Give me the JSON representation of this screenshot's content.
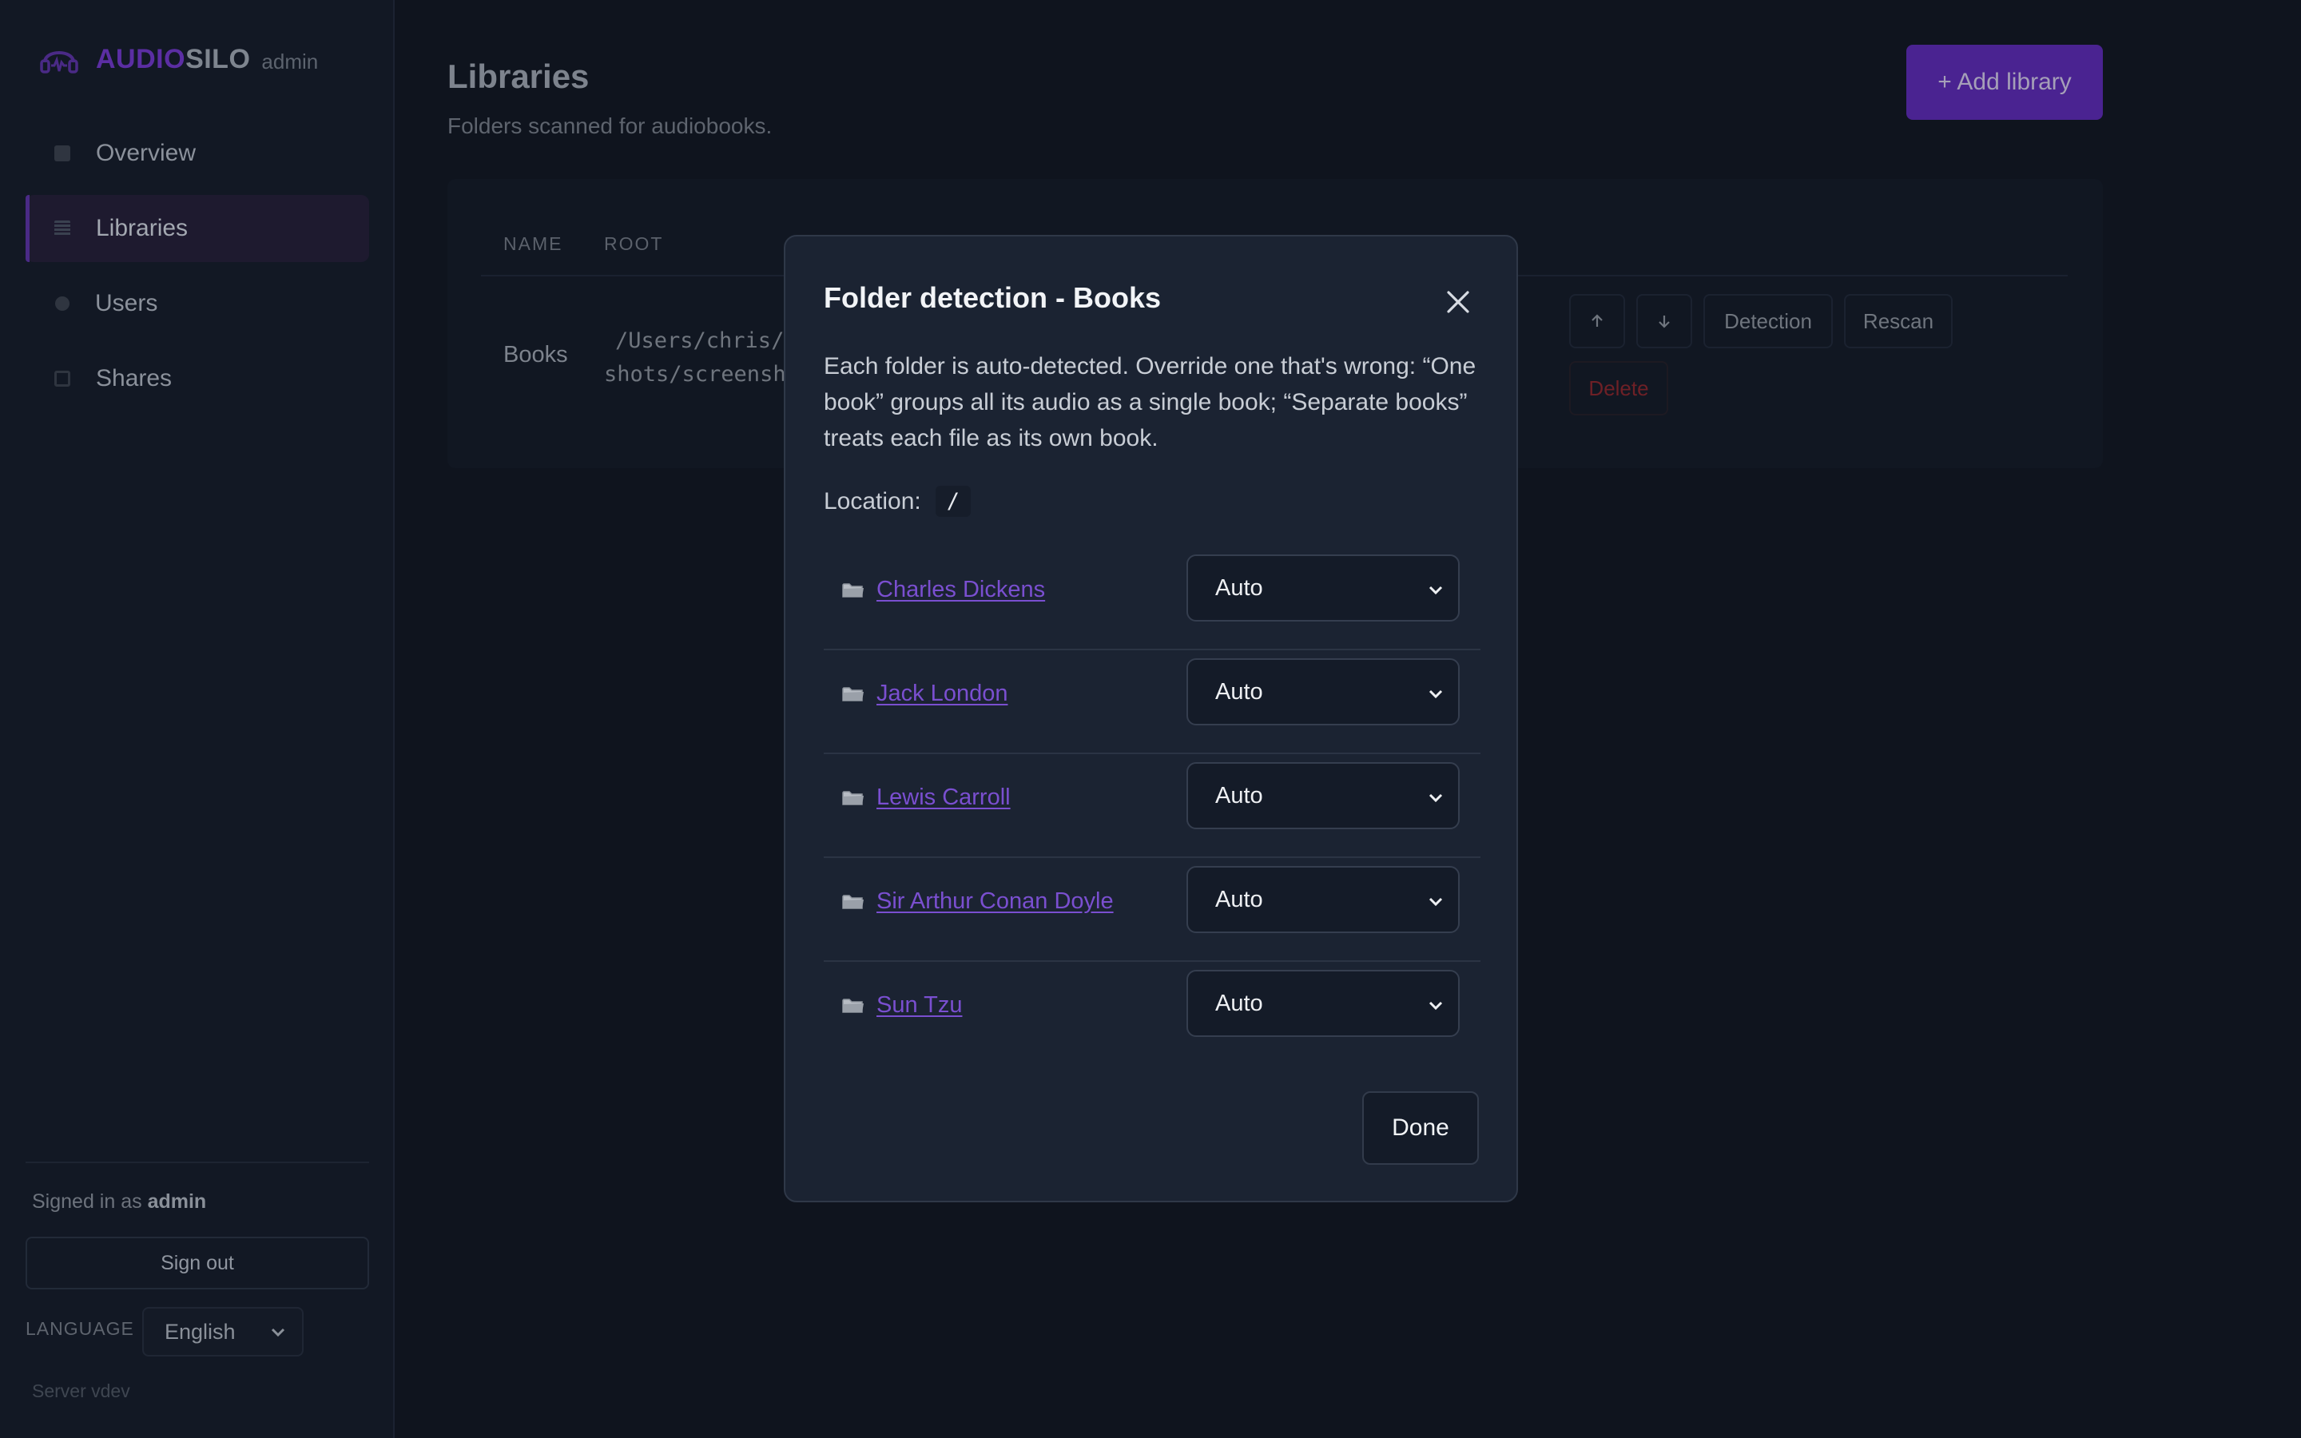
{
  "brand": {
    "name_a": "AUDIO",
    "name_b": "SILO",
    "role": "admin",
    "logo_icon": "headphones-waveform-icon"
  },
  "sidebar": {
    "items": [
      {
        "label": "Overview",
        "icon": "square-icon"
      },
      {
        "label": "Libraries",
        "icon": "list-icon",
        "active": true
      },
      {
        "label": "Users",
        "icon": "dot-icon"
      },
      {
        "label": "Shares",
        "icon": "share-icon"
      }
    ],
    "signed_prefix": "Signed in as",
    "signed_user": "admin",
    "sign_out": "Sign out",
    "language_label": "LANGUAGE",
    "language_value": "English",
    "server": "Server vdev"
  },
  "main": {
    "title": "Libraries",
    "subtitle": "Folders scanned for audiobooks.",
    "add_button": "+ Add library",
    "table": {
      "headers": [
        "NAME",
        "ROOT"
      ],
      "row": {
        "name": "Books",
        "root_line1": "/Users/chris/c",
        "root_line2": "shots/screensho",
        "detection": "Detection",
        "rescan": "Rescan",
        "delete": "Delete"
      }
    }
  },
  "modal": {
    "title": "Folder detection - Books",
    "description": "Each folder is auto-detected. Override one that's wrong: “One book” groups all its audio as a single book; “Separate books” treats each file as its own book.",
    "location_label": "Location:",
    "location_value": "/",
    "folders": [
      {
        "name": "Charles Dickens",
        "mode": "Auto"
      },
      {
        "name": "Jack London",
        "mode": "Auto"
      },
      {
        "name": "Lewis Carroll",
        "mode": "Auto"
      },
      {
        "name": "Sir Arthur Conan Doyle",
        "mode": "Auto"
      },
      {
        "name": "Sun Tzu",
        "mode": "Auto"
      }
    ],
    "done": "Done"
  },
  "colors": {
    "accent": "#7a4fd0",
    "danger": "#c0392b",
    "modal_bg": "#1b2332",
    "page_bg": "#0f141e"
  }
}
